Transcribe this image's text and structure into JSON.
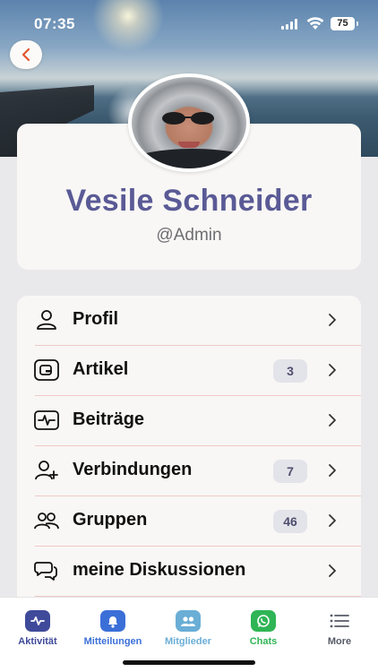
{
  "status_bar": {
    "time": "07:35",
    "battery": "75",
    "icons": [
      "cellular-signal-icon",
      "wifi-icon",
      "battery-icon"
    ]
  },
  "header": {
    "back_icon": "chevron-left-icon"
  },
  "profile": {
    "name": "Vesile Schneider",
    "role": "@Admin"
  },
  "menu": {
    "items": [
      {
        "label": "Profil",
        "icon": "person-icon",
        "count": ""
      },
      {
        "label": "Artikel",
        "icon": "article-icon",
        "count": "3"
      },
      {
        "label": "Beiträge",
        "icon": "activity-pulse-icon",
        "count": ""
      },
      {
        "label": "Verbindungen",
        "icon": "add-person-icon",
        "count": "7"
      },
      {
        "label": "Gruppen",
        "icon": "group-icon",
        "count": "46"
      },
      {
        "label": "meine Diskussionen",
        "icon": "discussion-bubbles-icon",
        "count": ""
      }
    ]
  },
  "tabbar": {
    "tabs": [
      {
        "label": "Aktivität",
        "icon": "activity-icon",
        "color": "#3f4a9a"
      },
      {
        "label": "Mitteilungen",
        "icon": "bell-icon",
        "color": "#3b6fd8"
      },
      {
        "label": "Mitglieder",
        "icon": "members-icon",
        "color": "#6aaed6"
      },
      {
        "label": "Chats",
        "icon": "whatsapp-icon",
        "color": "#2fb555"
      },
      {
        "label": "More",
        "icon": "menu-lines-icon",
        "color": "#555a66"
      }
    ]
  },
  "colors": {
    "accent": "#5a5a96",
    "divider": "#f0c9c6",
    "badge_bg": "#e3e3ea"
  }
}
